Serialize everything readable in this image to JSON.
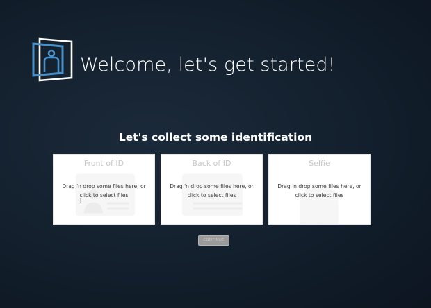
{
  "header": {
    "logo_icon": "id-badge-frame-icon",
    "title": "Welcome, let's get started!"
  },
  "main": {
    "subtitle": "Let's collect some identification",
    "cards": [
      {
        "title": "Front of ID",
        "dropzone_text": "Drag 'n drop some files here, or click to select files",
        "illustration_icon": "id-card-front-icon"
      },
      {
        "title": "Back of ID",
        "dropzone_text": "Drag 'n drop some files here, or click to select files",
        "illustration_icon": "id-card-back-icon"
      },
      {
        "title": "Selfie",
        "dropzone_text": "Drag 'n drop some files here, or click to select files",
        "illustration_icon": "person-silhouette-icon"
      }
    ],
    "continue_label": "CONTINUE",
    "continue_disabled": true
  },
  "colors": {
    "background": "#14212f",
    "logo_blue": "#4a90c8",
    "card_background": "#ffffff",
    "button_disabled": "#9a9a9a"
  }
}
